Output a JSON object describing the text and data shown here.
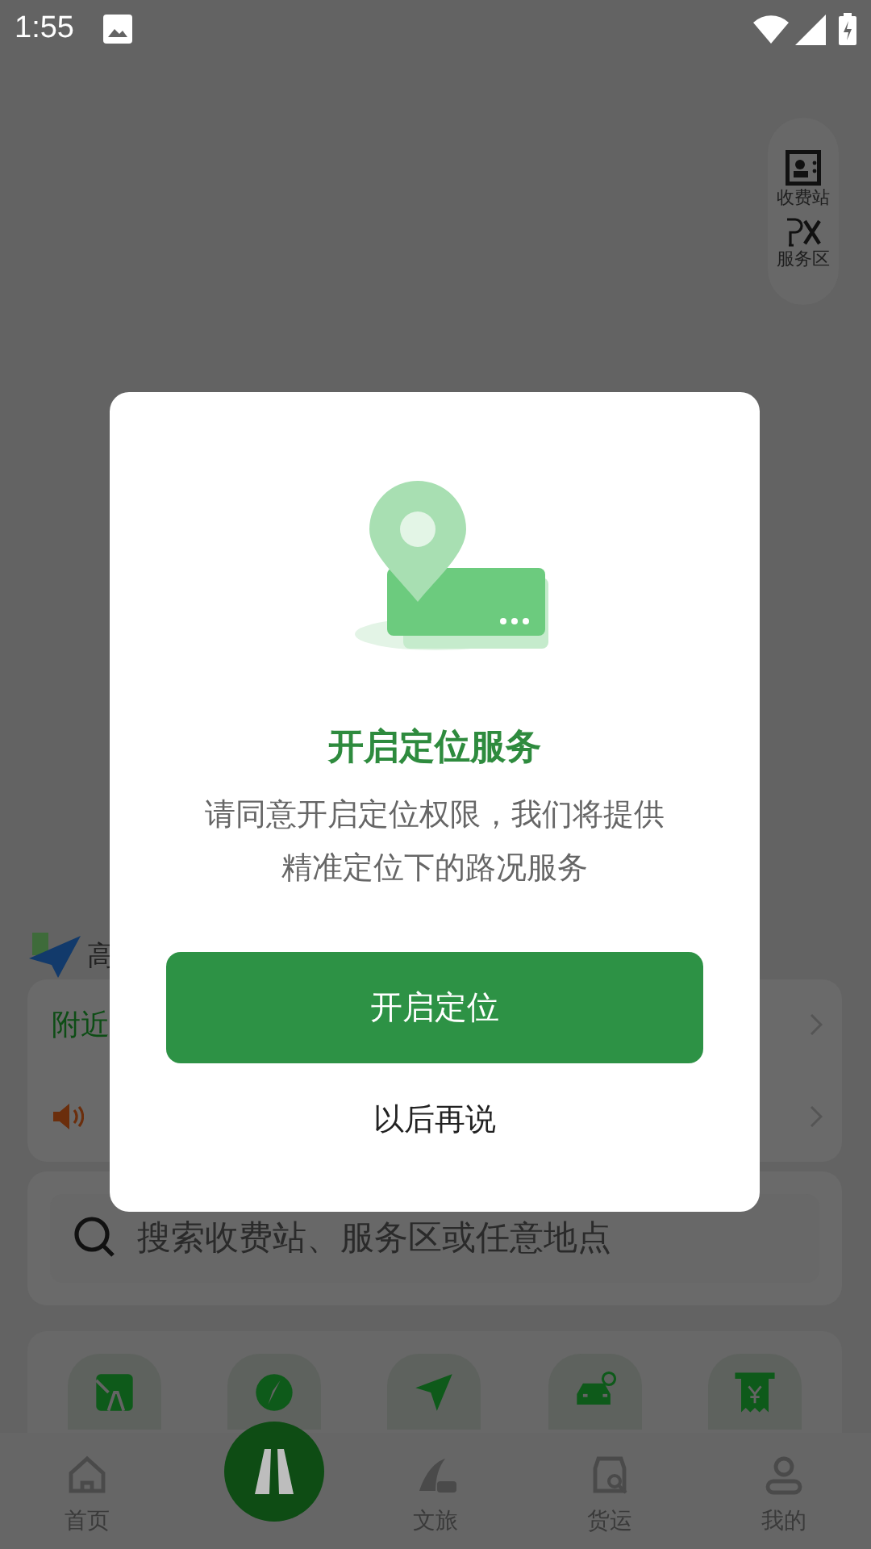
{
  "status_bar": {
    "time": "1:55"
  },
  "map_tools": [
    {
      "kind": "toll",
      "label": "收费站"
    },
    {
      "kind": "service",
      "label": "服务区"
    }
  ],
  "brand": {
    "text": "高"
  },
  "notice_card": {
    "rows": [
      {
        "kind": "nearby",
        "text": "附近"
      },
      {
        "kind": "broadcast"
      }
    ]
  },
  "search": {
    "placeholder": "搜索收费站、服务区或任意地点"
  },
  "shortcuts": [
    {
      "kind": "road"
    },
    {
      "kind": "compass"
    },
    {
      "kind": "navigate"
    },
    {
      "kind": "car"
    },
    {
      "kind": "toll-fee"
    }
  ],
  "bottom_nav": [
    {
      "kind": "home",
      "label": "首页"
    },
    {
      "kind": "center"
    },
    {
      "kind": "travel",
      "label": "文旅"
    },
    {
      "kind": "freight",
      "label": "货运"
    },
    {
      "kind": "me",
      "label": "我的"
    }
  ],
  "dialog": {
    "title": "开启定位服务",
    "message": [
      "请同意开启定位权限，我们将提供",
      "精准定位下的路况服务"
    ],
    "primary_button": "开启定位",
    "secondary_button": "以后再说"
  }
}
